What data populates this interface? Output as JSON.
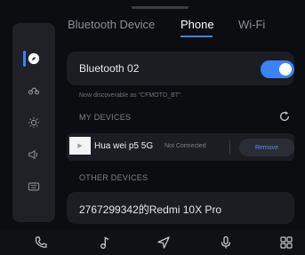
{
  "tabs": [
    {
      "label": "Bluetooth Device",
      "active": false
    },
    {
      "label": "Phone",
      "active": true
    },
    {
      "label": "Wi-Fi",
      "active": false
    }
  ],
  "sidebar": {
    "items": [
      {
        "icon": "compass-icon",
        "active": true
      },
      {
        "icon": "car-icon",
        "active": false
      },
      {
        "icon": "brightness-icon",
        "active": false
      },
      {
        "icon": "volume-icon",
        "active": false
      },
      {
        "icon": "keyboard-icon",
        "active": false
      }
    ]
  },
  "bluetooth": {
    "name": "Bluetooth 02",
    "enabled": true,
    "discoverable_text": "Now discoverable as \"CFMOTO_BT\"."
  },
  "my_devices": {
    "title": "MY DEVICES",
    "devices": [
      {
        "name": "Hua wei p5 5G",
        "status": "Not Connected",
        "action": "Remove"
      }
    ]
  },
  "other_devices": {
    "title": "OTHER DEVICES",
    "devices": [
      {
        "name": "2767299342的Redmi 10X Pro"
      }
    ]
  },
  "bottom_bar": {
    "icons": [
      "phone-icon",
      "music-icon",
      "navigation-icon",
      "microphone-icon",
      "apps-grid-icon"
    ]
  },
  "colors": {
    "accent": "#3b82f6",
    "background": "#0c0d10",
    "card": "#1b1d22"
  }
}
